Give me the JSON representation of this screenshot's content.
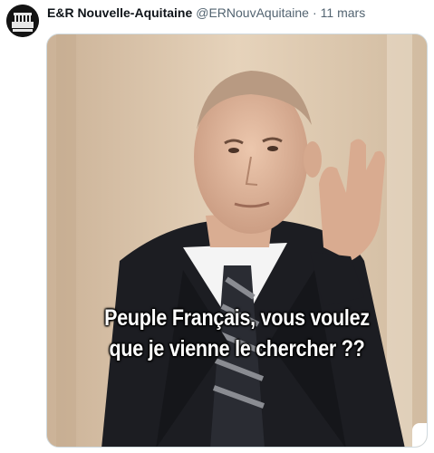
{
  "tweet": {
    "author_name": "E&R Nouvelle-Aquitaine",
    "author_handle": "@ERNouvAquitaine",
    "separator": "·",
    "date": "11 mars",
    "avatar_icon": "egalite-reconciliation-logo",
    "avatar_text_top": "ÉGALITÉ",
    "avatar_text_bottom": "AQUITAINE",
    "media": {
      "caption_line1": "Peuple Français, vous voulez",
      "caption_line2": "que je vienne le chercher ??"
    }
  }
}
